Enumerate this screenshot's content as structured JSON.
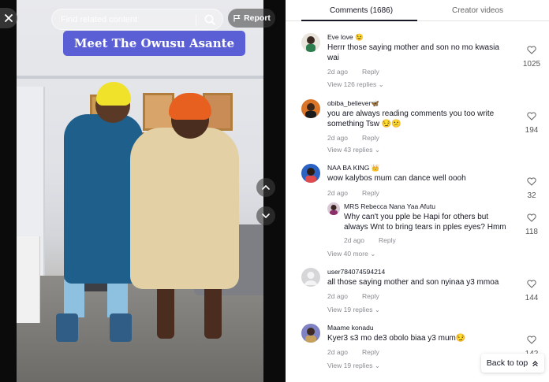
{
  "search": {
    "placeholder": "Find related content"
  },
  "report": {
    "label": "Report"
  },
  "banner": {
    "text": "Meet The Owusu Asante"
  },
  "tabs": {
    "comments": "Comments (1686)",
    "creator": "Creator videos"
  },
  "scroll_hint": "1025",
  "back_to_top": "Back to top",
  "comments": [
    {
      "user": "Eve love 😉",
      "text": "Herrr those saying mother and son no mo kwasia wai",
      "time": "2d ago",
      "reply": "Reply",
      "likes": "1025",
      "view_replies": "View 126 replies"
    },
    {
      "user": "obiba_believer🦋",
      "text": "you are always reading comments you too write something Tsw 😏😕",
      "time": "2d ago",
      "reply": "Reply",
      "likes": "194",
      "view_replies": "View 43 replies"
    },
    {
      "user": "NAA BA KING 👑",
      "text": "wow kalybos mum can dance well oooh",
      "time": "2d ago",
      "reply": "Reply",
      "likes": "32",
      "sub": {
        "user": "MRS Rebecca Nana Yaa Afutu",
        "text": "Why can't you pple be Hapi for others but always Wnt to bring tears in pples eyes? Hmm",
        "time": "2d ago",
        "reply": "Reply",
        "likes": "118"
      },
      "view_replies": "View 40 more"
    },
    {
      "user": "user784074594214",
      "text": "all those saying mother and son nyinaa y3 mmoa",
      "time": "2d ago",
      "reply": "Reply",
      "likes": "144",
      "view_replies": "View 19 replies"
    },
    {
      "user": "Maame konadu",
      "text": "Kyer3 s3 mo de3 obolo biaa y3 mum😏",
      "time": "2d ago",
      "reply": "Reply",
      "likes": "142",
      "view_replies": "View 19 replies"
    }
  ],
  "colors": {
    "banner_bg": "#5a5fd6",
    "text": "#161823",
    "muted": "#8a8b91"
  }
}
